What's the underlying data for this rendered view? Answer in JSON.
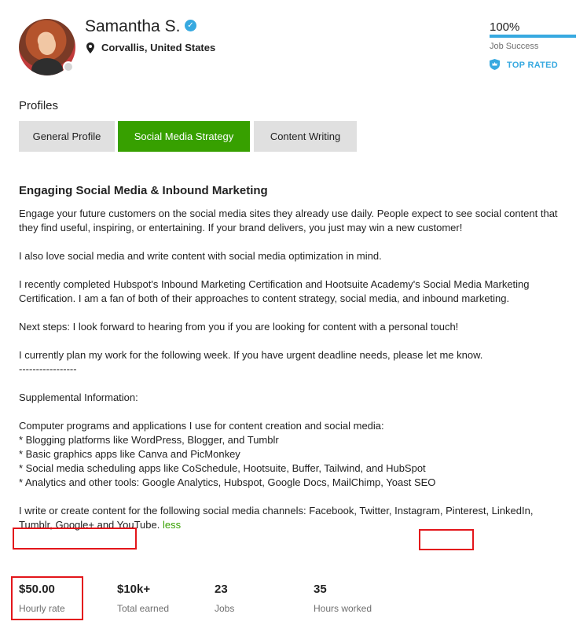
{
  "profile": {
    "name": "Samantha S.",
    "location": "Corvallis, United States"
  },
  "job_success": {
    "value": "100%",
    "fraction": 1.0,
    "label": "Job Success",
    "badge": "TOP RATED"
  },
  "profiles": {
    "heading": "Profiles",
    "tabs": [
      {
        "label": "General Profile",
        "active": false
      },
      {
        "label": "Social Media Strategy",
        "active": true
      },
      {
        "label": "Content Writing",
        "active": false
      }
    ]
  },
  "overview": {
    "headline": "Engaging Social Media & Inbound Marketing",
    "p1": "Engage your future customers on the social media sites they already use daily. People expect to see social content that they find useful, inspiring, or entertaining. If your brand delivers, you just may win a new customer!",
    "p2": "I also love social media and write content with social media optimization in mind.",
    "p3": "I recently completed Hubspot's Inbound Marketing Certification and Hootsuite Academy's Social Media Marketing Certification. I am a fan of both of their approaches to content strategy, social media, and inbound marketing.",
    "p4": "Next steps: I look forward to hearing from you if you are looking for content with a personal touch!",
    "p5": "I currently plan my work for the following week. If you have urgent deadline needs, please let me know.",
    "divider": "-----------------",
    "p6": "Supplemental Information:",
    "p7": "Computer programs and applications I use for content creation and social media:",
    "bullets": [
      "* Blogging platforms like WordPress, Blogger, and Tumblr",
      "* Basic graphics apps like Canva and PicMonkey",
      "* Social media scheduling apps like CoSchedule, Hootsuite, Buffer, Tailwind, and HubSpot",
      "* Analytics and other tools: Google Analytics, Hubspot, Google Docs, MailChimp, Yoast SEO"
    ],
    "p8": "I write or create content for the following social media channels: Facebook, Twitter, Instagram, Pinterest, LinkedIn, Tumblr, Google+ and YouTube.",
    "less_label": "less"
  },
  "stats": [
    {
      "value": "$50.00",
      "label": "Hourly rate"
    },
    {
      "value": "$10k+",
      "label": "Total earned"
    },
    {
      "value": "23",
      "label": "Jobs"
    },
    {
      "value": "35",
      "label": "Hours worked"
    }
  ],
  "colors": {
    "accent_green": "#37a000",
    "accent_blue": "#37a9e0",
    "highlight_red": "#e3161b"
  },
  "icons": {
    "verified": "verified-check-icon",
    "location": "map-pin-icon",
    "top_rated": "shield-crown-icon"
  }
}
